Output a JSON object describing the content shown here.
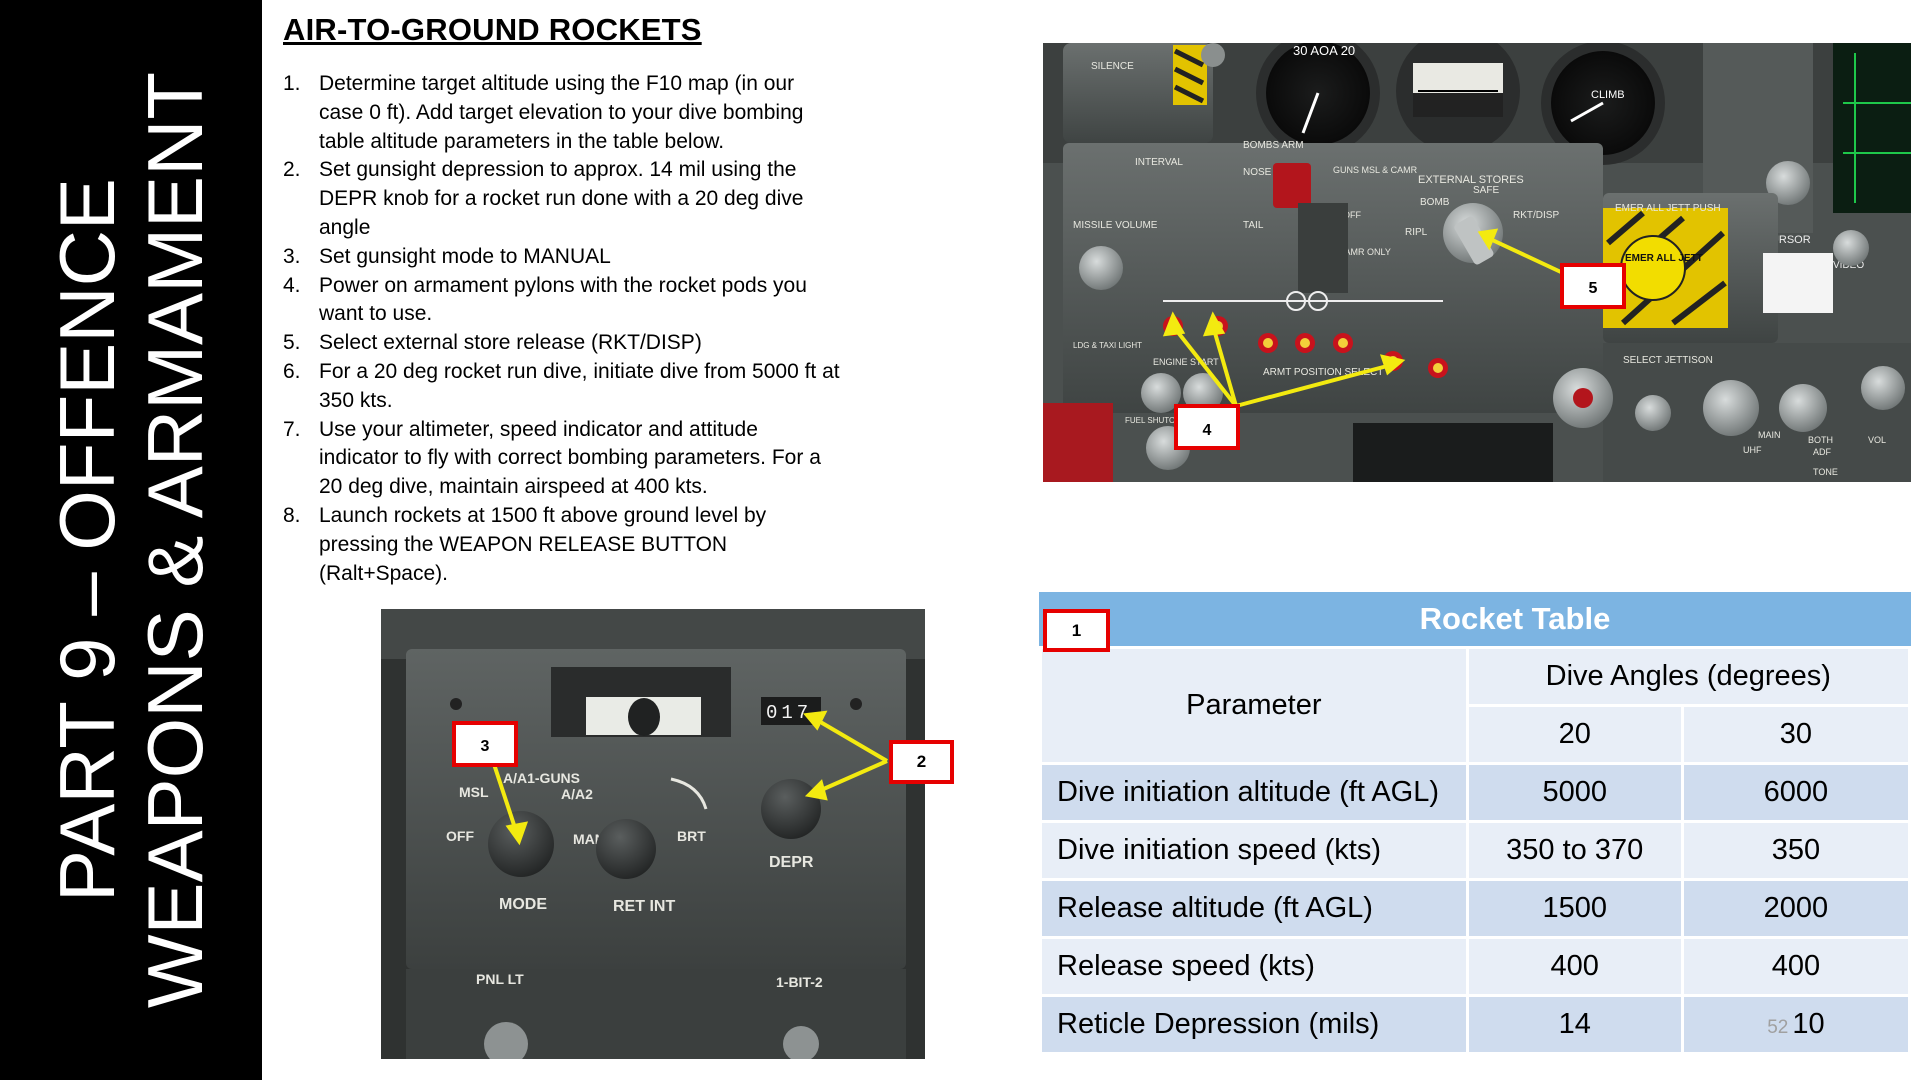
{
  "banner": {
    "line1": "PART  9 – OFFENCE",
    "line2": "WEAPONS & ARMAMENT"
  },
  "title": "AIR-TO-GROUND ROCKETS",
  "steps": [
    {
      "num": "1.",
      "text": "Determine target altitude using the F10 map (in our case 0 ft). Add target elevation to your dive bombing table altitude parameters in the table below."
    },
    {
      "num": "2.",
      "text": "Set gunsight depression to approx. 14 mil using the DEPR knob for a rocket run done with a 20 deg dive angle"
    },
    {
      "num": "3.",
      "text": "Set gunsight mode to MANUAL"
    },
    {
      "num": "4.",
      "text": "Power on armament pylons with the rocket pods you want to use."
    },
    {
      "num": "5.",
      "text": "Select external store release (RKT/DISP)"
    },
    {
      "num": "6.",
      "text": "For a 20 deg rocket run dive, initiate dive from 5000 ft at 350 kts."
    },
    {
      "num": "7.",
      "text": "Use your altimeter, speed indicator and attitude indicator to fly with correct bombing parameters. For a 20 deg dive, maintain airspeed at 400 kts."
    },
    {
      "num": "8.",
      "text": "Launch rockets at 1500 ft above ground level by pressing the WEAPON RELEASE BUTTON (Ralt+Space)."
    }
  ],
  "cockpit": {
    "labels": {
      "silence": "SILENCE",
      "aoa": "30 AOA 20",
      "interval": "INTERVAL",
      "bombs_arm": "BOMBS ARM",
      "nose": "NOSE",
      "tail": "TAIL",
      "guns": "GUNS MSL & CAMR",
      "off": "OFF",
      "camr_only": "CAMR ONLY",
      "external_stores": "EXTERNAL STORES",
      "bomb": "BOMB",
      "rkt_disp": "RKT/DISP",
      "ripl": "RIPL",
      "safe": "SAFE",
      "missile_volume": "MISSILE VOLUME",
      "engine_start": "ENGINE START",
      "armt_position_select": "ARMT POSITION SELECT",
      "emer_all_jett_push": "EMER ALL JETT PUSH",
      "emer_all_jett": "EMER ALL JETT",
      "select_jettison": "SELECT JETTISON",
      "climb": "CLIMB",
      "cursor": "CURSOR",
      "video": "VIDEO",
      "ldg_taxi_light": "LDG & TAXI LIGHT",
      "fuel_shutoff": "FUEL SHUTOFF",
      "uhf": "UHF",
      "main": "MAIN",
      "both": "BOTH",
      "adf": "ADF",
      "vol": "VOL",
      "tone": "TONE"
    },
    "callouts": {
      "c4": "4",
      "c5": "5"
    }
  },
  "gunsight": {
    "counter": "017",
    "labels": {
      "msl": "MSL",
      "aa1_guns": "A/A1-GUNS",
      "aa2": "A/A2",
      "off": "OFF",
      "man": "MAN",
      "brt": "BRT",
      "mode": "MODE",
      "ret_int": "RET INT",
      "depr": "DEPR",
      "pnl_lt": "PNL LT",
      "bit": "1-BIT-2"
    },
    "callouts": {
      "c2": "2",
      "c3": "3"
    }
  },
  "table": {
    "callout": "1",
    "title": "Rocket Table",
    "param_header": "Parameter",
    "group_header": "Dive Angles (degrees)",
    "angles": [
      "20",
      "30"
    ],
    "rows": [
      {
        "param": "Dive initiation altitude (ft AGL)",
        "v20": "5000",
        "v30": "6000"
      },
      {
        "param": "Dive initiation speed (kts)",
        "v20": "350 to 370",
        "v30": "350"
      },
      {
        "param": "Release altitude (ft AGL)",
        "v20": "1500",
        "v30": "2000"
      },
      {
        "param": "Release speed (kts)",
        "v20": "400",
        "v30": "400"
      },
      {
        "param": "Reticle Depression (mils)",
        "v20": "14",
        "v30": "10"
      }
    ],
    "page_number": "52"
  }
}
